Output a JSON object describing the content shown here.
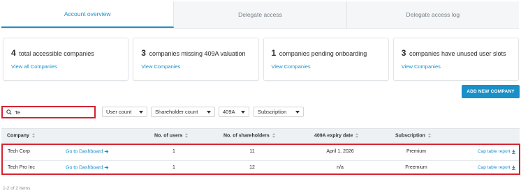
{
  "tabs": [
    {
      "label": "Account overview"
    },
    {
      "label": "Delegate access"
    },
    {
      "label": "Delegate access log"
    }
  ],
  "cards": [
    {
      "count": "4",
      "text": "total accessible companies",
      "link": "View all Companies"
    },
    {
      "count": "3",
      "text": "companies missing 409A valuation",
      "link": "View Companies"
    },
    {
      "count": "1",
      "text": "companies pending onboarding",
      "link": "View Companies"
    },
    {
      "count": "3",
      "text": "companies have unused user slots",
      "link": "View Companies"
    }
  ],
  "add_company_label": "ADD NEW COMPANY",
  "search": {
    "value": "Te"
  },
  "filters": [
    {
      "label": "User count"
    },
    {
      "label": "Shareholder count"
    },
    {
      "label": "409A"
    },
    {
      "label": "Subscription"
    }
  ],
  "table": {
    "headers": {
      "company": "Company",
      "users": "No. of users",
      "shareholders": "No. of shareholders",
      "expiry": "409A expiry date",
      "subscription": "Subscription"
    },
    "rows": [
      {
        "company": "Tech Corp",
        "dashboard": "Go to Dashboard",
        "users": "1",
        "shareholders": "11",
        "expiry": "April 1, 2026",
        "subscription": "Premium",
        "report": "Cap table report"
      },
      {
        "company": "Tech Pro Inc",
        "dashboard": "Go to Dashboard",
        "users": "1",
        "shareholders": "12",
        "expiry": "n/a",
        "subscription": "Freemium",
        "report": "Cap table report"
      }
    ]
  },
  "pagination": "1-2 of 2 items",
  "colors": {
    "accent": "#1a90c9",
    "highlight": "#d6232f"
  }
}
